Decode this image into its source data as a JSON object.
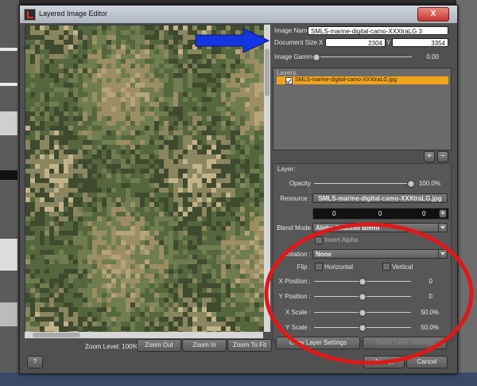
{
  "window": {
    "title": "Layered Image Editor",
    "close_label": "X"
  },
  "image_name": {
    "label": "Image Name :",
    "value": "SMLS-marine-digital-camo-XXXtraLG 3"
  },
  "document_size": {
    "label": "Document Size :",
    "x_label": "X",
    "x_value": "2304",
    "y_label": "Y",
    "y_value": "3354"
  },
  "image_gamma": {
    "label": "Image Gamma :",
    "value": "0.00",
    "level": 0.0
  },
  "layers": {
    "header": "Layers:",
    "items": [
      {
        "name": "SMLS-marine-digital-camo-XXXtraLG.jpg",
        "checked": true
      }
    ],
    "add_label": "+",
    "remove_label": "−"
  },
  "layer": {
    "header": "Layer:",
    "opacity": {
      "label": "Opacity :",
      "value": "100.0%",
      "level": 1.0
    },
    "resource": {
      "label": "Resource :",
      "value": "SMLS-marine-digital-camo-XXXtraLG.jpg"
    },
    "color": {
      "r": "0",
      "g": "0",
      "b": "0"
    },
    "blend_mode": {
      "label": "Blend Mode :",
      "value": "Alpha Channel Blend"
    },
    "invert_alpha": {
      "label": "Invert Alpha",
      "checked": false
    },
    "rotation": {
      "label": "Rotation :",
      "value": "None"
    },
    "flip": {
      "label": "Flip :",
      "horizontal": "Horizontal",
      "vertical": "Vertical"
    },
    "x_position": {
      "label": "X Position :",
      "value": "0",
      "level": 0.5
    },
    "y_position": {
      "label": "Y Position :",
      "value": "0",
      "level": 0.5
    },
    "x_scale": {
      "label": "X Scale :",
      "value": "50.0%",
      "level": 0.5
    },
    "y_scale": {
      "label": "Y Scale :",
      "value": "50.0%",
      "level": 0.5
    }
  },
  "zoom": {
    "label": "Zoom Level: 100%",
    "zoom_out": "Zoom Out",
    "zoom_in": "Zoom In",
    "zoom_fit": "Zoom To Fit"
  },
  "buttons": {
    "copy": "Copy Layer Settings",
    "paste": "Paste Layer Settings",
    "accept": "Accept",
    "cancel": "Cancel",
    "help": "?"
  },
  "colors": {
    "selected_layer": "#f2a31b",
    "annotation_arrow": "#1436e0",
    "annotation_circle": "#e01818",
    "close_button": "#c33"
  }
}
